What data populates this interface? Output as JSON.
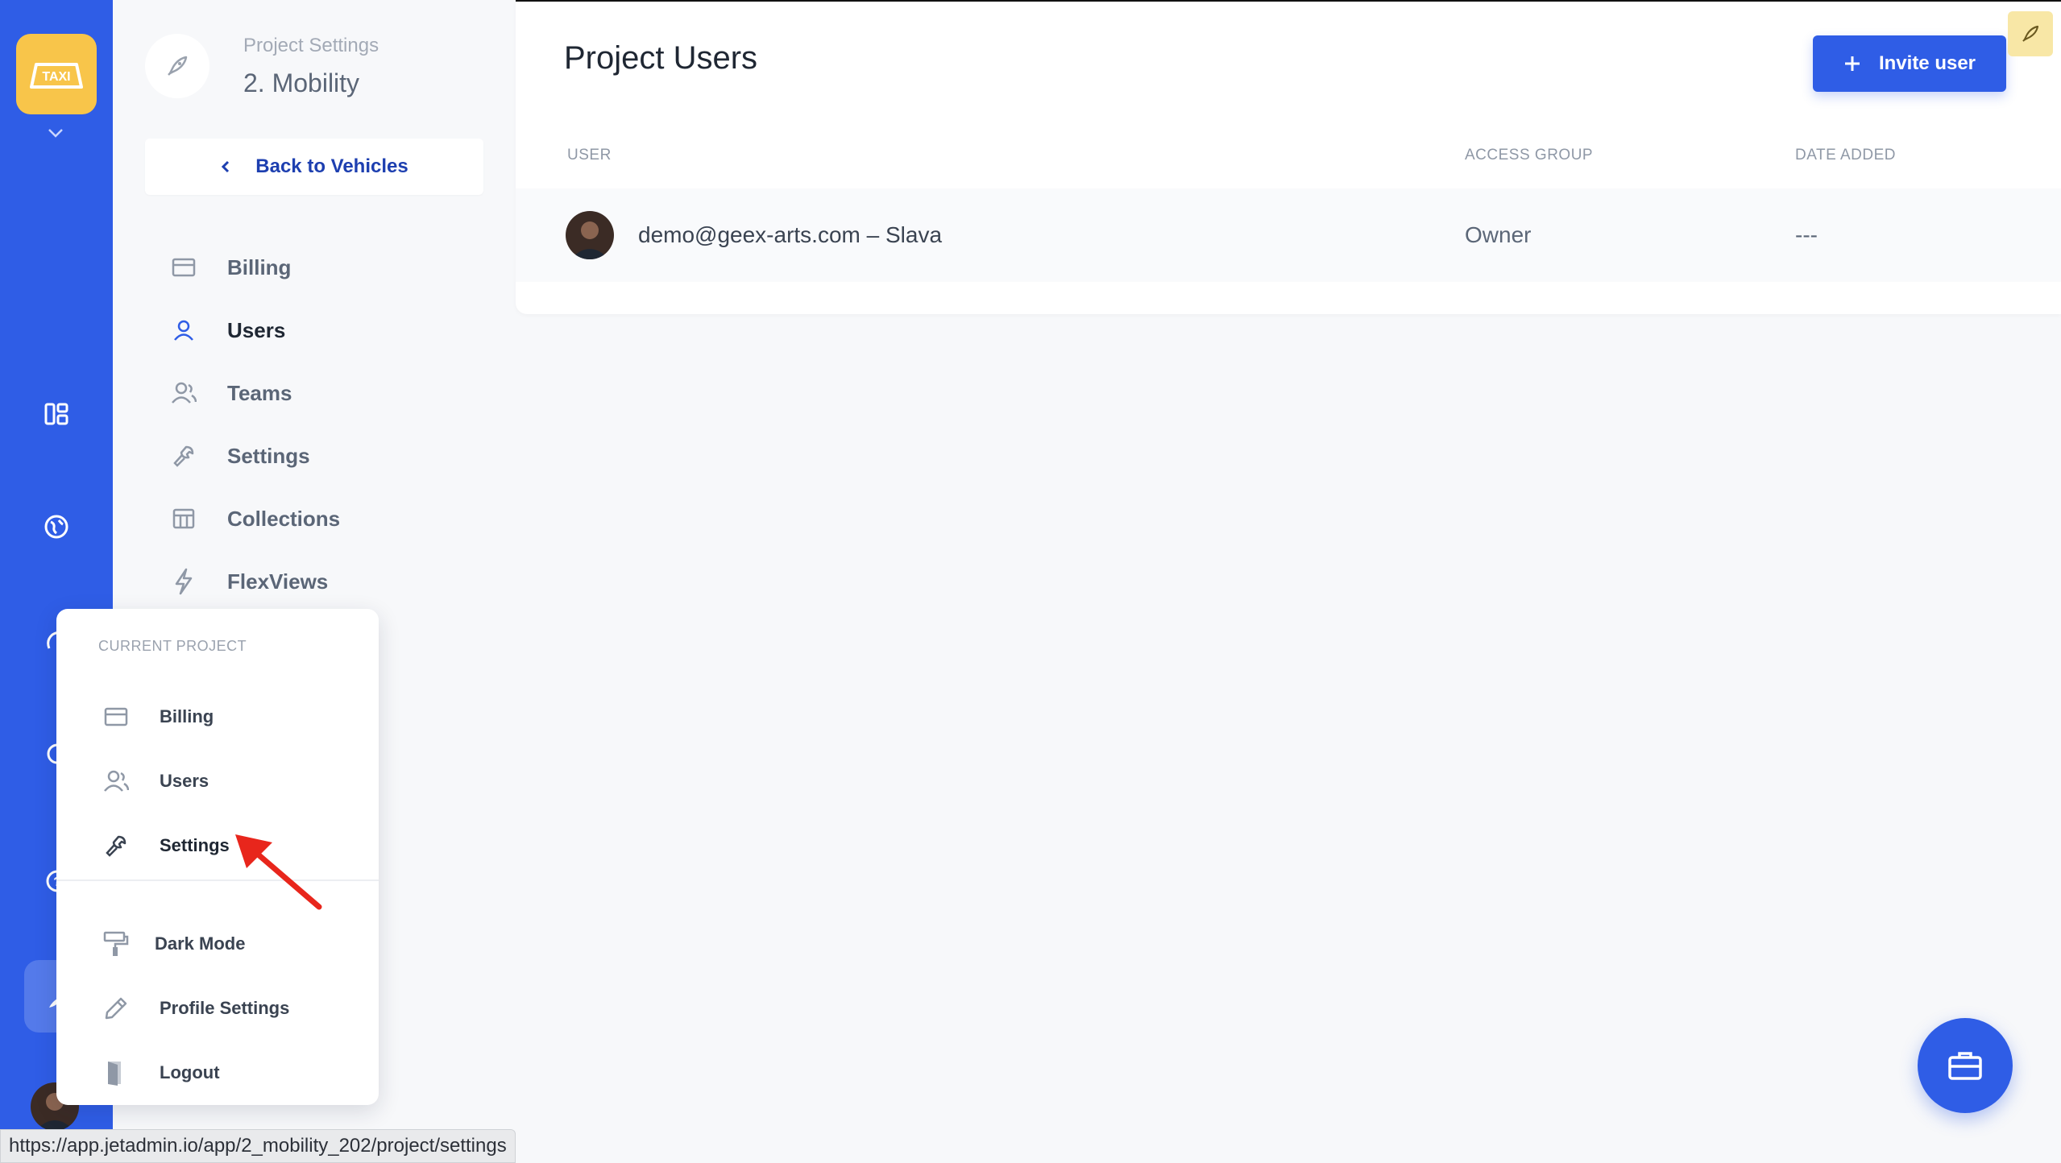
{
  "rail": {
    "logo_text": "TAXI",
    "colors": {
      "rail": "#2f5de6",
      "logo": "#f8c54a"
    }
  },
  "project": {
    "subtitle": "Project Settings",
    "title": "2. Mobility",
    "back_label": "Back to Vehicles"
  },
  "nav": {
    "items": [
      {
        "label": "Billing",
        "icon": "billing-icon"
      },
      {
        "label": "Users",
        "icon": "user-icon"
      },
      {
        "label": "Teams",
        "icon": "team-icon"
      },
      {
        "label": "Settings",
        "icon": "wrench-icon"
      },
      {
        "label": "Collections",
        "icon": "table-icon"
      },
      {
        "label": "FlexViews",
        "icon": "lightning-icon"
      }
    ]
  },
  "main": {
    "title": "Project Users",
    "invite_label": "Invite user",
    "table": {
      "columns": [
        "USER",
        "ACCESS GROUP",
        "DATE ADDED"
      ],
      "rows": [
        {
          "user": "demo@geex-arts.com – Slava",
          "access_group": "Owner",
          "date_added": "---"
        }
      ]
    }
  },
  "menu": {
    "header": "CURRENT PROJECT",
    "project_items": [
      {
        "label": "Billing",
        "icon": "billing-icon"
      },
      {
        "label": "Users",
        "icon": "users-icon"
      },
      {
        "label": "Settings",
        "icon": "wrench-icon"
      }
    ],
    "account_items": [
      {
        "label": "Dark Mode",
        "icon": "paint-roller-icon"
      },
      {
        "label": "Profile Settings",
        "icon": "pencil-icon"
      },
      {
        "label": "Logout",
        "icon": "door-icon"
      }
    ]
  },
  "status_url": "https://app.jetadmin.io/app/2_mobility_202/project/settings",
  "colors": {
    "accent": "#2f5de6",
    "annotation_arrow": "#e8261c"
  }
}
